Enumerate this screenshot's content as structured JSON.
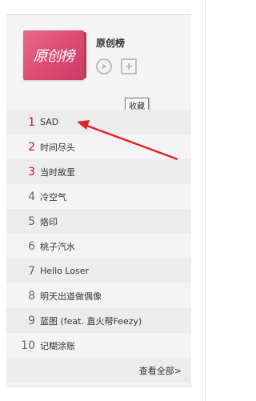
{
  "chart": {
    "cover_text": "原创榜",
    "title": "原创榜",
    "play_icon": "play-icon",
    "add_icon": "add-to-folder-icon",
    "tooltip": "收藏"
  },
  "songs": [
    {
      "rank": "1",
      "title": "SAD"
    },
    {
      "rank": "2",
      "title": "时间尽头"
    },
    {
      "rank": "3",
      "title": "当时故里"
    },
    {
      "rank": "4",
      "title": "冷空气"
    },
    {
      "rank": "5",
      "title": "烙印"
    },
    {
      "rank": "6",
      "title": "桃子汽水"
    },
    {
      "rank": "7",
      "title": "Hello Loser"
    },
    {
      "rank": "8",
      "title": "明天出道做偶像"
    },
    {
      "rank": "9",
      "title": "蓝图 (feat. 直火帮Feezy)"
    },
    {
      "rank": "10",
      "title": "记糊涂账"
    }
  ],
  "footer": {
    "more_label": "查看全部>"
  },
  "annotation": {
    "arrow_color": "#e0242a"
  }
}
